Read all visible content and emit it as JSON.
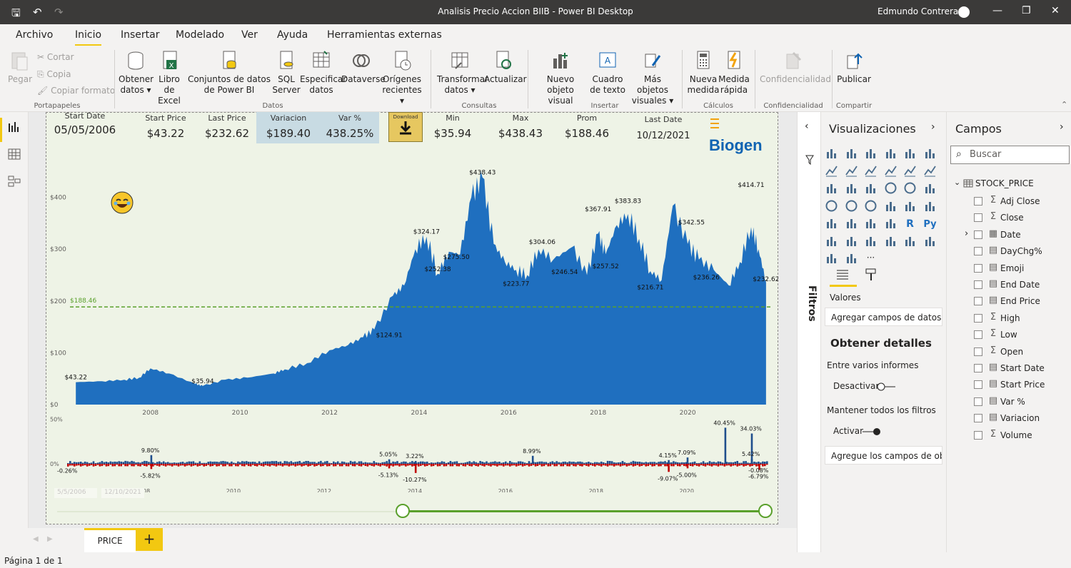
{
  "window": {
    "title": "Analisis Precio Accion BIIB - Power BI Desktop",
    "user": "Edmundo Contreras"
  },
  "menu": [
    "Archivo",
    "Inicio",
    "Insertar",
    "Modelado",
    "Ver",
    "Ayuda",
    "Herramientas externas"
  ],
  "ribbon": {
    "paste": "Pegar",
    "cut": "Cortar",
    "copy": "Copia",
    "format": "Copiar formato",
    "get_data": "Obtener datos",
    "excel": "Libro de Excel",
    "datasets": "Conjuntos de datos de Power BI",
    "sql": "SQL Server",
    "enter_data": "Especificar datos",
    "dataverse": "Dataverse",
    "recent": "Orígenes recientes",
    "transform": "Transformar datos",
    "refresh": "Actualizar",
    "new_visual": "Nuevo objeto visual",
    "textbox": "Cuadro de texto",
    "more_visuals": "Más objetos visuales",
    "new_measure": "Nueva medida",
    "quick_measure": "Medida rápida",
    "sensitivity": "Confidencialidad",
    "publish": "Publicar",
    "groups": [
      "Portapapeles",
      "Datos",
      "Consultas",
      "Insertar",
      "Cálculos",
      "Confidencialidad",
      "Compartir"
    ]
  },
  "kpis": {
    "start_date_label": "Start Date",
    "start_date": "05/05/2006",
    "start_price_label": "Start Price",
    "start_price": "$43.22",
    "last_price_label": "Last Price",
    "last_price": "$232.62",
    "variacion_label": "Variacion",
    "variacion": "$189.40",
    "var_pct_label": "Var %",
    "var_pct": "438.25%",
    "download_label": "Download",
    "min_label": "Min",
    "min": "$35.94",
    "max_label": "Max",
    "max": "$438.43",
    "prom_label": "Prom",
    "prom": "$188.46",
    "last_date_label": "Last Date",
    "last_date": "10/12/2021",
    "logo": "Biogen"
  },
  "chart_data": [
    {
      "type": "area",
      "title": "",
      "series": [
        {
          "name": "Close",
          "x": [
            "2006-05",
            "2006-12",
            "2007-06",
            "2007-10",
            "2008-01",
            "2008-06",
            "2009-01",
            "2009-03",
            "2009-09",
            "2010-03",
            "2010-10",
            "2011-01",
            "2011-07",
            "2012-01",
            "2012-06",
            "2012-10",
            "2013-01",
            "2013-06",
            "2013-09",
            "2013-12",
            "2014-03",
            "2014-06",
            "2014-09",
            "2014-12",
            "2015-03",
            "2015-06",
            "2015-09",
            "2015-12",
            "2016-03",
            "2016-06",
            "2016-09",
            "2017-01",
            "2017-06",
            "2017-10",
            "2018-01",
            "2018-03",
            "2018-06",
            "2018-09",
            "2018-12",
            "2019-03",
            "2019-06",
            "2019-09",
            "2020-01",
            "2020-04",
            "2020-08",
            "2020-12",
            "2021-03",
            "2021-06",
            "2021-08",
            "2021-10"
          ],
          "y": [
            43.22,
            45,
            48,
            52,
            70,
            60,
            40,
            35.94,
            48,
            52,
            60,
            68,
            80,
            105,
            115,
            130,
            145,
            210,
            230,
            300,
            324.17,
            252.38,
            295,
            290,
            400,
            438.43,
            310,
            275.5,
            260,
            250,
            300,
            280,
            304.06,
            250,
            330,
            290,
            346.54,
            367.91,
            320,
            257.52,
            240,
            383.83,
            310,
            280,
            260,
            230,
            275,
            342.55,
            300,
            236.26
          ]
        }
      ],
      "xlabel": "",
      "ylabel": "",
      "x_ticks": [
        "2008",
        "2010",
        "2012",
        "2014",
        "2016",
        "2018",
        "2020"
      ],
      "y_ticks": [
        "$0",
        "$100",
        "$200",
        "$300",
        "$400"
      ],
      "ylim": [
        0,
        460
      ],
      "reference_line": {
        "label": "$188.46",
        "value": 188.46
      },
      "annotations": [
        {
          "x": "2006-05",
          "y": 43.22,
          "text": "$43.22"
        },
        {
          "x": "2009-03",
          "y": 35.94,
          "text": "$35.94"
        },
        {
          "x": "2013-05",
          "y": 124.91,
          "text": "$124.91"
        },
        {
          "x": "2014-06",
          "y": 252.38,
          "text": "$252.38"
        },
        {
          "x": "2014-03",
          "y": 324.17,
          "text": "$324.17"
        },
        {
          "x": "2014-11",
          "y": 275.5,
          "text": "$275.50"
        },
        {
          "x": "2015-06",
          "y": 438.43,
          "text": "$438.43"
        },
        {
          "x": "2016-03",
          "y": 223.77,
          "text": "$223.77"
        },
        {
          "x": "2016-10",
          "y": 304.06,
          "text": "$304.06"
        },
        {
          "x": "2017-04",
          "y": 246.54,
          "text": "$246.54"
        },
        {
          "x": "2018-01",
          "y": 367.91,
          "text": "$367.91"
        },
        {
          "x": "2018-03",
          "y": 257.52,
          "text": "$257.52"
        },
        {
          "x": "2018-09",
          "y": 383.83,
          "text": "$383.83"
        },
        {
          "x": "2019-03",
          "y": 216.71,
          "text": "$216.71"
        },
        {
          "x": "2020-02",
          "y": 342.55,
          "text": "$342.55"
        },
        {
          "x": "2020-06",
          "y": 236.26,
          "text": "$236.26"
        },
        {
          "x": "2021-06",
          "y": 414.71,
          "text": "$414.71"
        },
        {
          "x": "2021-10",
          "y": 232.62,
          "text": "$232.62"
        }
      ],
      "colors": {
        "area": "#1f6fbf",
        "ref": "#5aa02c"
      }
    },
    {
      "type": "bar",
      "title": "",
      "xlabel": "",
      "ylabel": "",
      "x_ticks": [
        "2008",
        "2010",
        "2012",
        "2014",
        "2016",
        "2018",
        "2020"
      ],
      "y_ticks": [
        "0%",
        "50%"
      ],
      "annotations": [
        {
          "x": "2006-05",
          "y": -0.26,
          "text": "-0.26%"
        },
        {
          "x": "2008-03",
          "y": 9.8,
          "text": "9.80%"
        },
        {
          "x": "2008-03",
          "y": -5.82,
          "text": "-5.82%"
        },
        {
          "x": "2013-06",
          "y": 5.05,
          "text": "5.05%"
        },
        {
          "x": "2013-06",
          "y": -5.13,
          "text": "-5.13%"
        },
        {
          "x": "2014-01",
          "y": 3.22,
          "text": "3.22%"
        },
        {
          "x": "2014-01",
          "y": -10.27,
          "text": "-10.27%"
        },
        {
          "x": "2016-08",
          "y": 8.99,
          "text": "8.99%"
        },
        {
          "x": "2019-08",
          "y": 4.15,
          "text": "4.15%"
        },
        {
          "x": "2019-08",
          "y": -9.07,
          "text": "-9.07%"
        },
        {
          "x": "2020-01",
          "y": 7.09,
          "text": "7.09%"
        },
        {
          "x": "2020-01",
          "y": -5.0,
          "text": "-5.00%"
        },
        {
          "x": "2020-11",
          "y": 40.45,
          "text": "40.45%"
        },
        {
          "x": "2021-06",
          "y": 34.03,
          "text": "34.03%"
        },
        {
          "x": "2021-06",
          "y": 5.42,
          "text": "5.42%"
        },
        {
          "x": "2021-08",
          "y": -0.08,
          "text": "-0.08%"
        },
        {
          "x": "2021-08",
          "y": -6.79,
          "text": "-6.79%"
        }
      ],
      "colors": {
        "pos": "#1f4e8c",
        "neg": "#c00000"
      }
    }
  ],
  "slider": {
    "from": "5/5/2006",
    "to": "12/10/2021"
  },
  "page_tab": "PRICE",
  "status": "Página 1 de 1",
  "filters_label": "Filtros",
  "viz": {
    "title": "Visualizaciones",
    "values_label": "Valores",
    "add_fields": "Agregar campos de datos a...",
    "details_title": "Obtener detalles",
    "cross_report": "Entre varios informes",
    "off_label": "Desactivar",
    "keep_filters": "Mantener todos los filtros",
    "on_label": "Activar",
    "drill_fields": "Agregue los campos de ob..."
  },
  "fields": {
    "title": "Campos",
    "search_placeholder": "Buscar",
    "table": "STOCK_PRICE",
    "items": [
      {
        "name": "Adj Close",
        "sym": "Σ"
      },
      {
        "name": "Close",
        "sym": "Σ"
      },
      {
        "name": "Date",
        "sym": "▦"
      },
      {
        "name": "DayChg%",
        "sym": "▤"
      },
      {
        "name": "Emoji",
        "sym": "▤"
      },
      {
        "name": "End Date",
        "sym": "▤"
      },
      {
        "name": "End Price",
        "sym": "▤"
      },
      {
        "name": "High",
        "sym": "Σ"
      },
      {
        "name": "Low",
        "sym": "Σ"
      },
      {
        "name": "Open",
        "sym": "Σ"
      },
      {
        "name": "Start Date",
        "sym": "▤"
      },
      {
        "name": "Start Price",
        "sym": "▤"
      },
      {
        "name": "Var %",
        "sym": "▤"
      },
      {
        "name": "Variacion",
        "sym": "▤"
      },
      {
        "name": "Volume",
        "sym": "Σ"
      }
    ]
  }
}
